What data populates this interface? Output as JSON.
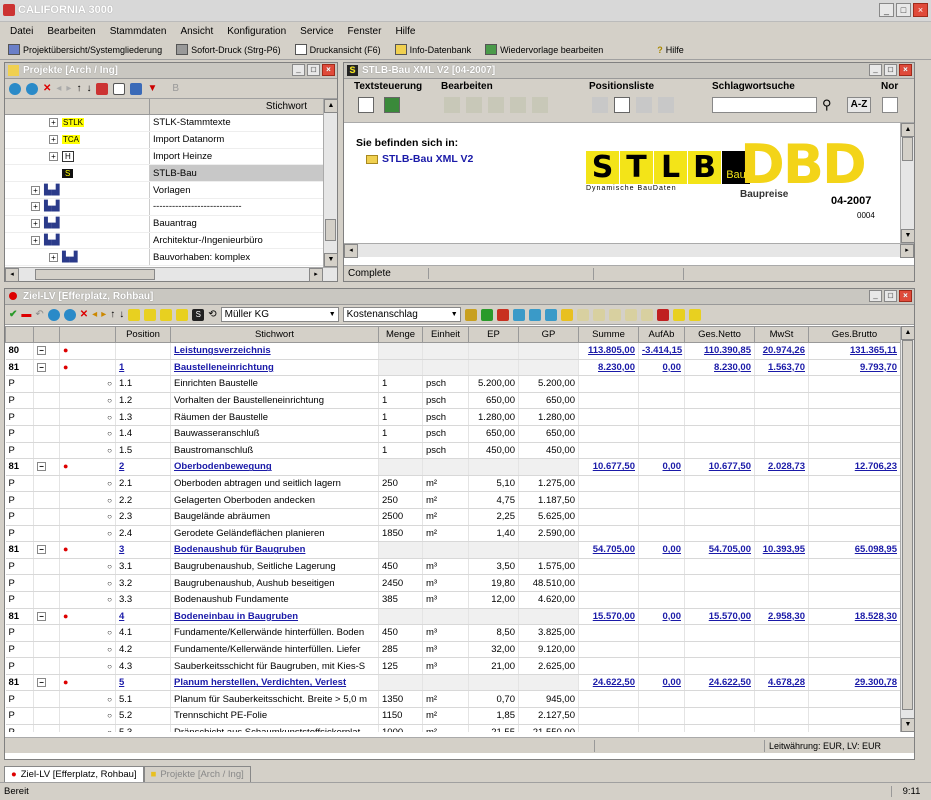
{
  "app": {
    "title": "CALIFORNIA 3000"
  },
  "menu": [
    "Datei",
    "Bearbeiten",
    "Stammdaten",
    "Ansicht",
    "Konfiguration",
    "Service",
    "Fenster",
    "Hilfe"
  ],
  "toolbar": [
    "Projektübersicht/Systemgliederung",
    "Sofort-Druck (Strg-P6)",
    "Druckansicht (F6)",
    "Info-Datenbank",
    "Wiedervorlage bearbeiten",
    "Hilfe"
  ],
  "projekte": {
    "title": "Projekte [Arch / Ing]",
    "column": "Stichwort",
    "rows": [
      {
        "badge": "STLK",
        "label": "STLK-Stammtexte"
      },
      {
        "badge": "TCA",
        "label": "Import Datanorm"
      },
      {
        "badge": "H",
        "label": "Import Heinze"
      },
      {
        "badge": "S",
        "label": "STLB-Bau"
      },
      {
        "badge": "",
        "label": "Vorlagen"
      },
      {
        "badge": "",
        "label": "----------------------------"
      },
      {
        "badge": "",
        "label": "Bauantrag"
      },
      {
        "badge": "",
        "label": "Architektur-/Ingenieurbüro"
      },
      {
        "badge": "",
        "label": "Bauvorhaben: komplex"
      }
    ]
  },
  "stlb": {
    "title": "STLB-Bau XML V2 [04-2007]",
    "groups": [
      "Textsteuerung",
      "Bearbeiten",
      "Positionsliste",
      "Schlagwortsuche",
      "Nor"
    ],
    "az": "A-Z",
    "location_label": "Sie befinden sich in:",
    "location_item": "STLB-Bau XML V2",
    "logo_letters": [
      "S",
      "T",
      "L",
      "B"
    ],
    "logo_sub": "Bau",
    "logo_tagline": "Dynamische BauDaten",
    "dbd": "DBD",
    "dbd_sub": "Baupreise",
    "date": "04-2007",
    "code": "0004",
    "status": "Complete"
  },
  "lv": {
    "title": "Ziel-LV [Efferplatz, Rohbau]",
    "combo1": "Müller KG",
    "combo2": "Kostenanschlag",
    "headers": [
      "",
      "",
      "",
      "Position",
      "Stichwort",
      "Menge",
      "Einheit",
      "EP",
      "GP",
      "Summe",
      "AufAb",
      "Ges.Netto",
      "MwSt",
      "Ges.Brutto"
    ],
    "rows": [
      {
        "t": "80",
        "g": true,
        "pos": "",
        "txt": "Leistungsverzeichnis",
        "sum": "113.805,00",
        "auf": "-3.414,15",
        "net": "110.390,85",
        "mw": "20.974,26",
        "br": "131.365,11"
      },
      {
        "t": "81",
        "g": true,
        "pos": "1",
        "txt": "Baustelleneinrichtung",
        "sum": "8.230,00",
        "auf": "0,00",
        "net": "8.230,00",
        "mw": "1.563,70",
        "br": "9.793,70"
      },
      {
        "t": "P",
        "pos": "1.1",
        "txt": "Einrichten Baustelle",
        "m": "1",
        "e": "psch",
        "ep": "5.200,00",
        "gp": "5.200,00"
      },
      {
        "t": "P",
        "pos": "1.2",
        "txt": "Vorhalten der Baustelleneinrichtung",
        "m": "1",
        "e": "psch",
        "ep": "650,00",
        "gp": "650,00"
      },
      {
        "t": "P",
        "pos": "1.3",
        "txt": "Räumen der Baustelle",
        "m": "1",
        "e": "psch",
        "ep": "1.280,00",
        "gp": "1.280,00"
      },
      {
        "t": "P",
        "pos": "1.4",
        "txt": "Bauwasseranschluß",
        "m": "1",
        "e": "psch",
        "ep": "650,00",
        "gp": "650,00"
      },
      {
        "t": "P",
        "pos": "1.5",
        "txt": "Baustromanschluß",
        "m": "1",
        "e": "psch",
        "ep": "450,00",
        "gp": "450,00"
      },
      {
        "t": "81",
        "g": true,
        "pos": "2",
        "txt": "Oberbodenbewegung",
        "sum": "10.677,50",
        "auf": "0,00",
        "net": "10.677,50",
        "mw": "2.028,73",
        "br": "12.706,23"
      },
      {
        "t": "P",
        "pos": "2.1",
        "txt": "Oberboden abtragen und seitlich lagern",
        "m": "250",
        "e": "m²",
        "ep": "5,10",
        "gp": "1.275,00"
      },
      {
        "t": "P",
        "pos": "2.2",
        "txt": "Gelagerten Oberboden andecken",
        "m": "250",
        "e": "m²",
        "ep": "4,75",
        "gp": "1.187,50"
      },
      {
        "t": "P",
        "pos": "2.3",
        "txt": "Baugelände abräumen",
        "m": "2500",
        "e": "m²",
        "ep": "2,25",
        "gp": "5.625,00"
      },
      {
        "t": "P",
        "pos": "2.4",
        "txt": "Gerodete Geländeflächen planieren",
        "m": "1850",
        "e": "m²",
        "ep": "1,40",
        "gp": "2.590,00"
      },
      {
        "t": "81",
        "g": true,
        "pos": "3",
        "txt": "Bodenaushub für Baugruben",
        "sum": "54.705,00",
        "auf": "0,00",
        "net": "54.705,00",
        "mw": "10.393,95",
        "br": "65.098,95"
      },
      {
        "t": "P",
        "pos": "3.1",
        "txt": "Baugrubenaushub, Seitliche Lagerung",
        "m": "450",
        "e": "m³",
        "ep": "3,50",
        "gp": "1.575,00"
      },
      {
        "t": "P",
        "pos": "3.2",
        "txt": "Baugrubenaushub, Aushub beseitigen",
        "m": "2450",
        "e": "m³",
        "ep": "19,80",
        "gp": "48.510,00"
      },
      {
        "t": "P",
        "pos": "3.3",
        "txt": "Bodenaushub Fundamente",
        "m": "385",
        "e": "m³",
        "ep": "12,00",
        "gp": "4.620,00"
      },
      {
        "t": "81",
        "g": true,
        "pos": "4",
        "txt": "Bodeneinbau in Baugruben",
        "sum": "15.570,00",
        "auf": "0,00",
        "net": "15.570,00",
        "mw": "2.958,30",
        "br": "18.528,30"
      },
      {
        "t": "P",
        "pos": "4.1",
        "txt": "Fundamente/Kellerwände hinterfüllen. Boden",
        "m": "450",
        "e": "m³",
        "ep": "8,50",
        "gp": "3.825,00"
      },
      {
        "t": "P",
        "pos": "4.2",
        "txt": "Fundamente/Kellerwände hinterfüllen. Liefer",
        "m": "285",
        "e": "m³",
        "ep": "32,00",
        "gp": "9.120,00"
      },
      {
        "t": "P",
        "pos": "4.3",
        "txt": "Sauberkeitsschicht für Baugruben, mit Kies-S",
        "m": "125",
        "e": "m³",
        "ep": "21,00",
        "gp": "2.625,00"
      },
      {
        "t": "81",
        "g": true,
        "pos": "5",
        "txt": "Planum herstellen, Verdichten, Verlest",
        "sum": "24.622,50",
        "auf": "0,00",
        "net": "24.622,50",
        "mw": "4.678,28",
        "br": "29.300,78"
      },
      {
        "t": "P",
        "pos": "5.1",
        "txt": "Planum für Sauberkeitsschicht. Breite > 5,0 m",
        "m": "1350",
        "e": "m²",
        "ep": "0,70",
        "gp": "945,00"
      },
      {
        "t": "P",
        "pos": "5.2",
        "txt": "Trennschicht PE-Folie",
        "m": "1150",
        "e": "m²",
        "ep": "1,85",
        "gp": "2.127,50"
      },
      {
        "t": "P",
        "pos": "5.3",
        "txt": "Dränschicht aus Schaumkunststoffsickerplat",
        "m": "1000",
        "e": "m²",
        "ep": "21,55",
        "gp": "21.550,00"
      }
    ],
    "status_right": "Leitwährung: EUR, LV: EUR"
  },
  "tabs": [
    "Ziel-LV [Efferplatz, Rohbau]",
    "Projekte [Arch / Ing]"
  ],
  "status": {
    "left": "Bereit",
    "right": "9:11"
  }
}
